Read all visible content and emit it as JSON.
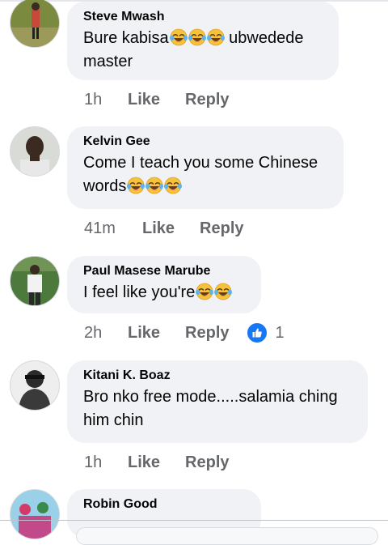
{
  "comments": [
    {
      "author": "Steve Mwash",
      "line1": "Bure kabisa",
      "line1_emojis": 3,
      "line1_after": " ubwedede",
      "line2": "master",
      "line2_emojis": 0,
      "time": "1h",
      "like_label": "Like",
      "reply_label": "Reply"
    },
    {
      "author": "Kelvin Gee",
      "line1": "Come I teach you some Chinese",
      "line1_emojis": 0,
      "line2": "words",
      "line2_emojis": 3,
      "time": "41m",
      "like_label": "Like",
      "reply_label": "Reply"
    },
    {
      "author": "Paul Masese Marube",
      "line1": "I feel like you're",
      "line1_emojis": 2,
      "time": "2h",
      "like_label": "Like",
      "reply_label": "Reply",
      "reaction_count": "1",
      "reaction_icon": "like-thumb-icon"
    },
    {
      "author": "Kitani K. Boaz",
      "line1": "Bro nko free mode.....salamia ching",
      "line1_emojis": 0,
      "line2": "him chin",
      "line2_emojis": 0,
      "time": "1h",
      "like_label": "Like",
      "reply_label": "Reply"
    },
    {
      "author": "Robin Good"
    }
  ],
  "colors": {
    "bubble": "#f0f2f5",
    "meta_text": "#65676b",
    "like_reaction": "#1877f2",
    "emoji_face": "#f7c23b"
  },
  "emoji_icon": "face-with-tears-of-joy-icon"
}
